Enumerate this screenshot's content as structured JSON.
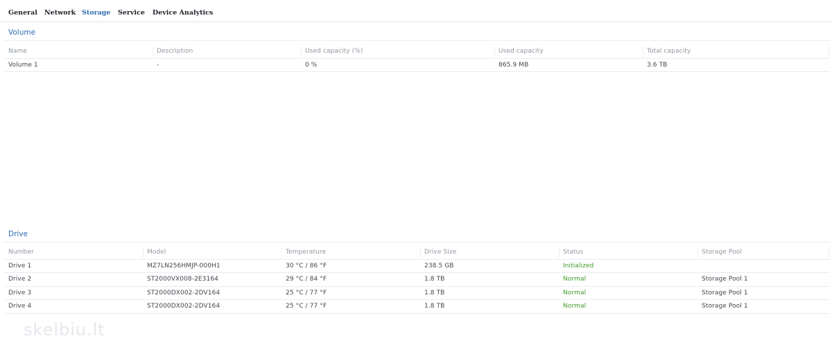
{
  "tabs": [
    {
      "label": "General"
    },
    {
      "label": "Network"
    },
    {
      "label": "Storage"
    },
    {
      "label": "Service"
    },
    {
      "label": "Device Analytics"
    }
  ],
  "active_tab": "Storage",
  "volume": {
    "title": "Volume",
    "headers": [
      "Name",
      "Description",
      "Used capacity (%)",
      "Used capacity",
      "Total capacity"
    ],
    "rows": [
      [
        "Volume 1",
        "-",
        "0 %",
        "865.9 MB",
        "3.6 TB"
      ]
    ]
  },
  "drive": {
    "title": "Drive",
    "headers": [
      "Number",
      "Model",
      "Temperature",
      "Drive Size",
      "Status",
      "Storage Pool"
    ],
    "rows": [
      [
        "Drive 1",
        "MZ7LN256HMJP-000H1",
        "30 °C / 86 °F",
        "238.5 GB",
        "Initialized",
        ""
      ],
      [
        "Drive 2",
        "ST2000VX008-2E3164",
        "29 °C / 84 °F",
        "1.8 TB",
        "Normal",
        "Storage Pool 1"
      ],
      [
        "Drive 3",
        "ST2000DX002-2DV164",
        "25 °C / 77 °F",
        "1.8 TB",
        "Normal",
        "Storage Pool 1"
      ],
      [
        "Drive 4",
        "ST2000DX002-2DV164",
        "25 °C / 77 °F",
        "1.8 TB",
        "Normal",
        "Storage Pool 1"
      ]
    ]
  },
  "colors": {
    "accent": "#2e6bb0",
    "status_ok": "#3c9a27"
  },
  "watermark": "skelbiu.lt"
}
